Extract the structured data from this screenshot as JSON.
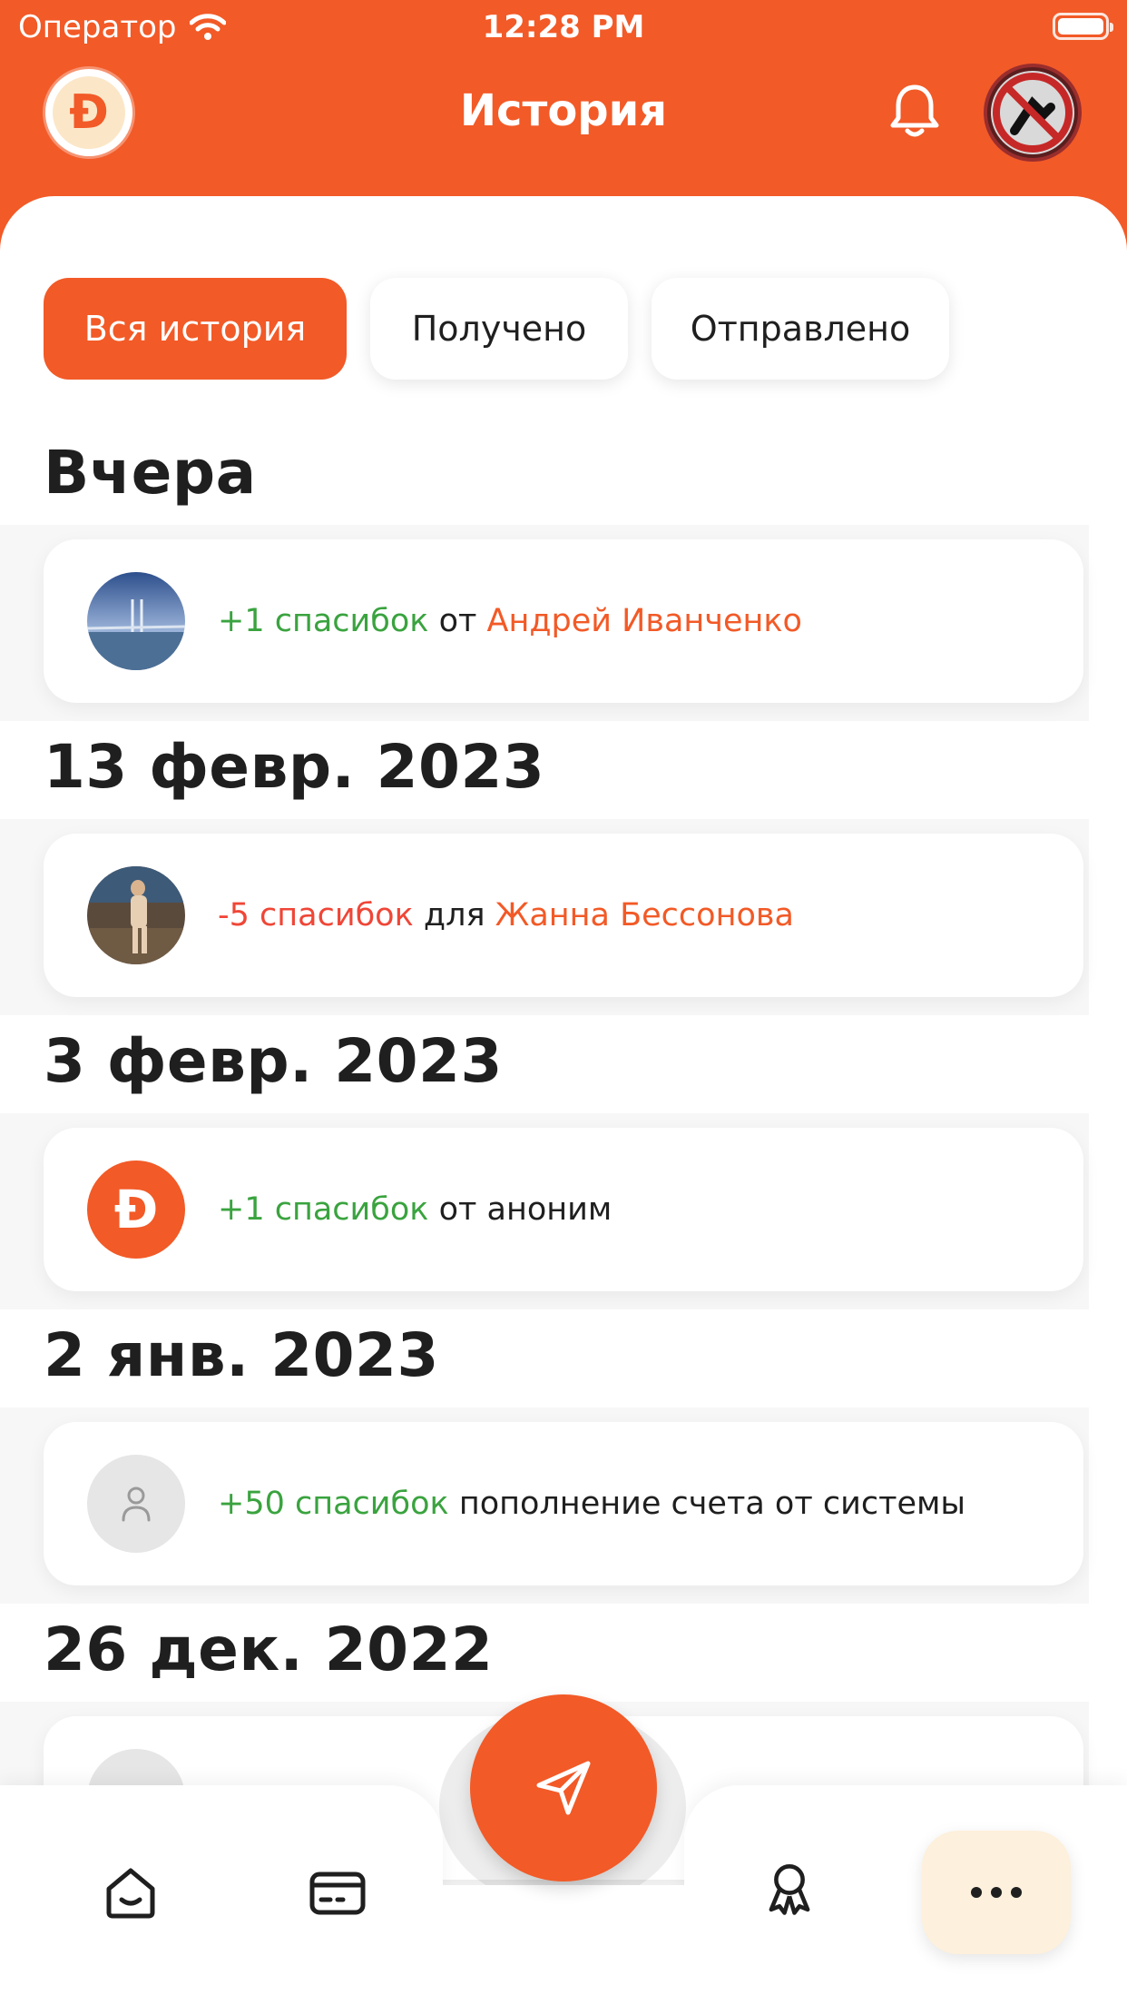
{
  "status_bar": {
    "carrier": "Оператор",
    "time": "12:28 PM"
  },
  "header": {
    "title": "История"
  },
  "filters": [
    {
      "label": "Вся история",
      "active": true
    },
    {
      "label": "Получено",
      "active": false
    },
    {
      "label": "Отправлено",
      "active": false
    }
  ],
  "groups": [
    {
      "date": "Вчера",
      "item": {
        "amount": "+1 спасибок",
        "amount_type": "plus",
        "connector": "от",
        "name": "Андрей Иванченко",
        "avatar": "photo-bridge"
      }
    },
    {
      "date": "13 февр. 2023",
      "item": {
        "amount": "-5 спасибок",
        "amount_type": "minus",
        "connector": "для",
        "name": "Жанна Бессонова",
        "avatar": "photo-person"
      }
    },
    {
      "date": "3 февр. 2023",
      "item": {
        "amount": "+1 спасибок",
        "amount_type": "plus",
        "connector": "от аноним",
        "name": "",
        "avatar": "brand-logo"
      }
    },
    {
      "date": "2 янв. 2023",
      "item": {
        "amount": "+50 спасибок",
        "amount_type": "plus",
        "connector": "пополнение счета от системы",
        "name": "",
        "avatar": "user-placeholder-icon"
      }
    },
    {
      "date": "26 дек. 2022"
    }
  ],
  "colors": {
    "accent": "#f25a27",
    "positive": "#3aa33f",
    "negative": "#ef4637",
    "more_button_bg": "#fdf0dc"
  },
  "bottom_nav": {
    "items": [
      "home-icon",
      "card-icon",
      "send-icon",
      "award-icon",
      "more-icon"
    ]
  }
}
